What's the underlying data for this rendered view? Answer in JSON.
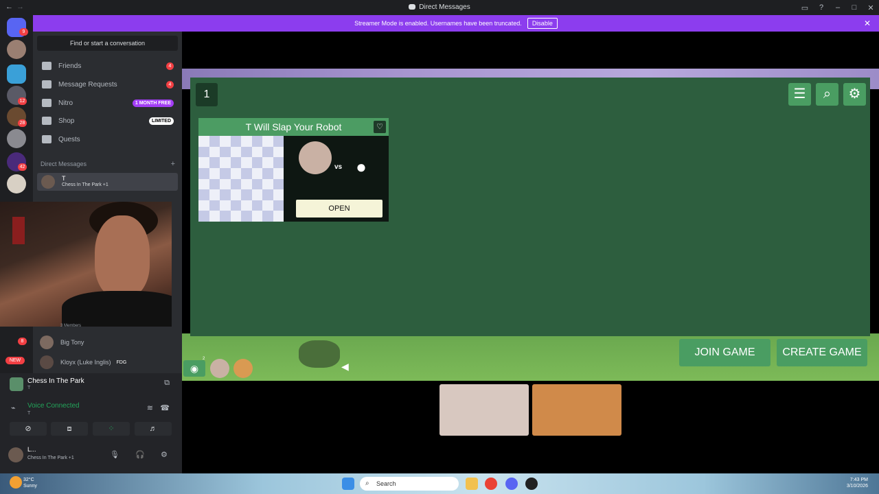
{
  "window": {
    "title": "Direct Messages"
  },
  "banner": {
    "text": "Streamer Mode is enabled. Usernames have been truncated.",
    "disable_label": "Disable"
  },
  "guild_badges": [
    "9",
    "12",
    "28",
    "42",
    "8",
    "NEW"
  ],
  "sidebar": {
    "search_placeholder": "Find or start a conversation",
    "nav": [
      {
        "label": "Friends",
        "badge": "4"
      },
      {
        "label": "Message Requests",
        "badge": "4"
      },
      {
        "label": "Nitro",
        "promo": "1 MONTH FREE"
      },
      {
        "label": "Shop",
        "tag": "LIMITED"
      },
      {
        "label": "Quests"
      }
    ],
    "dm_header": "Direct Messages",
    "dm_add": "+",
    "dm": {
      "name": "T",
      "activity": "Chess In The Park +1"
    },
    "members_count": "3 Members",
    "members": [
      {
        "name": "Big Tony"
      },
      {
        "name": "Kloyx (Luke Inglis)",
        "tag": "FDG"
      }
    ]
  },
  "voice_panel": {
    "activity_name": "Chess In The Park",
    "activity_sub": "T",
    "status": "Voice Connected",
    "status_sub": "T",
    "user_name": "L...",
    "user_activity": "Chess In The Park +1"
  },
  "game": {
    "round_number": "1",
    "card_title": "T Will Slap Your Robot",
    "vs_label": "vs",
    "open_label": "OPEN",
    "join_label": "JOIN GAME",
    "create_label": "CREATE GAME",
    "spectator_count": "2"
  },
  "taskbar": {
    "search_label": "Search",
    "weather_temp": "32°C",
    "weather_desc": "Sunny",
    "time": "7:43 PM",
    "date": "3/10/2026"
  },
  "colors": {
    "accent": "#8c3dee",
    "game_green": "#4a9d62",
    "board_green": "#2d5e3e",
    "voice_green": "#23a55a"
  }
}
